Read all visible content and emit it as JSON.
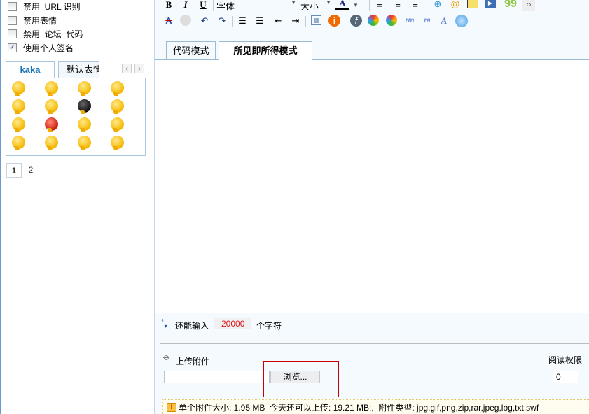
{
  "options": [
    {
      "label": "禁用  URL 识别",
      "checked": false
    },
    {
      "label": "禁用表情",
      "checked": false
    },
    {
      "label": "禁用  论坛  代码",
      "checked": false
    },
    {
      "label": "使用个人签名",
      "checked": true
    }
  ],
  "smilies": {
    "tabs": [
      "kaka",
      "默认表情"
    ],
    "active_tab": "kaka",
    "prev_icon": "‹",
    "next_icon": "›",
    "pages": [
      "1",
      "2"
    ],
    "current_page": "1",
    "count": 16
  },
  "toolbar": {
    "bold": "B",
    "italic": "I",
    "underline": "U",
    "font_label": "字体",
    "size_label": "大小",
    "color_label": "A"
  },
  "editor": {
    "tabs": [
      "代码模式",
      "所见即所得模式"
    ],
    "active_tab": "所见即所得模式",
    "content": ""
  },
  "status": {
    "prefix": "还能输入",
    "remaining": "20000",
    "suffix": "个字符"
  },
  "upload": {
    "label": "上传附件",
    "file_value": "",
    "browse_label": "浏览...",
    "perm_label": "阅读权限",
    "perm_value": "0",
    "info": "单个附件大小: 1.95 MB  今天还可以上传: 19.21 MB;,  附件类型: jpg,gif,png,zip,rar,jpeg,log,txt,swf"
  },
  "colors": {
    "accent": "#1a73b8",
    "count_red": "#e0161b",
    "highlight_box": "#cc0000"
  }
}
